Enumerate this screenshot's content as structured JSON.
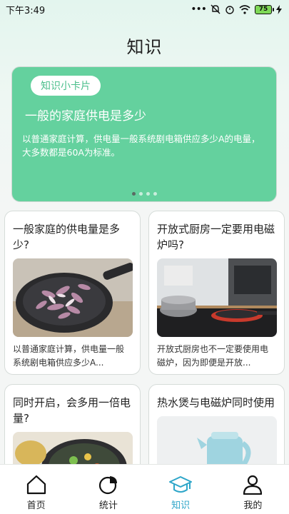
{
  "status_bar": {
    "time": "下午3:49",
    "battery": "75"
  },
  "page": {
    "title": "知识"
  },
  "hero": {
    "badge": "知识小卡片",
    "title": "一般的家庭供电是多少",
    "description": "以普通家庭计算，供电量一般系统剧电箱供应多少A的电量，大多数都是60A为标准。",
    "page_count": 4,
    "active_page": 1
  },
  "cards": [
    {
      "title": "一般家庭的供电量是多少?",
      "description": "以普通家庭计算，供电量一般系统剧电箱供应多少A...",
      "image": "pan-of-onions-photo"
    },
    {
      "title": "开放式厨房一定要用电磁炉吗?",
      "description": "开放式厨房也不一定要使用电磁炉，因为即便是开放...",
      "image": "kitchen-induction-photo"
    },
    {
      "title": "同时开启，会多用一倍电量?",
      "description": "",
      "image": "vegetable-pan-photo"
    },
    {
      "title": "热水煲与电磁炉同时使用",
      "description": "",
      "image": "kettle-photo"
    }
  ],
  "tabbar": {
    "items": [
      {
        "label": "首页",
        "icon": "home-icon",
        "active": false
      },
      {
        "label": "统计",
        "icon": "pie-chart-icon",
        "active": false
      },
      {
        "label": "知识",
        "icon": "graduation-cap-icon",
        "active": true
      },
      {
        "label": "我的",
        "icon": "user-icon",
        "active": false
      }
    ],
    "active_color": "#2ea6c9"
  },
  "colors": {
    "hero": "#64d19e",
    "badge_text": "#4cbf8c"
  }
}
